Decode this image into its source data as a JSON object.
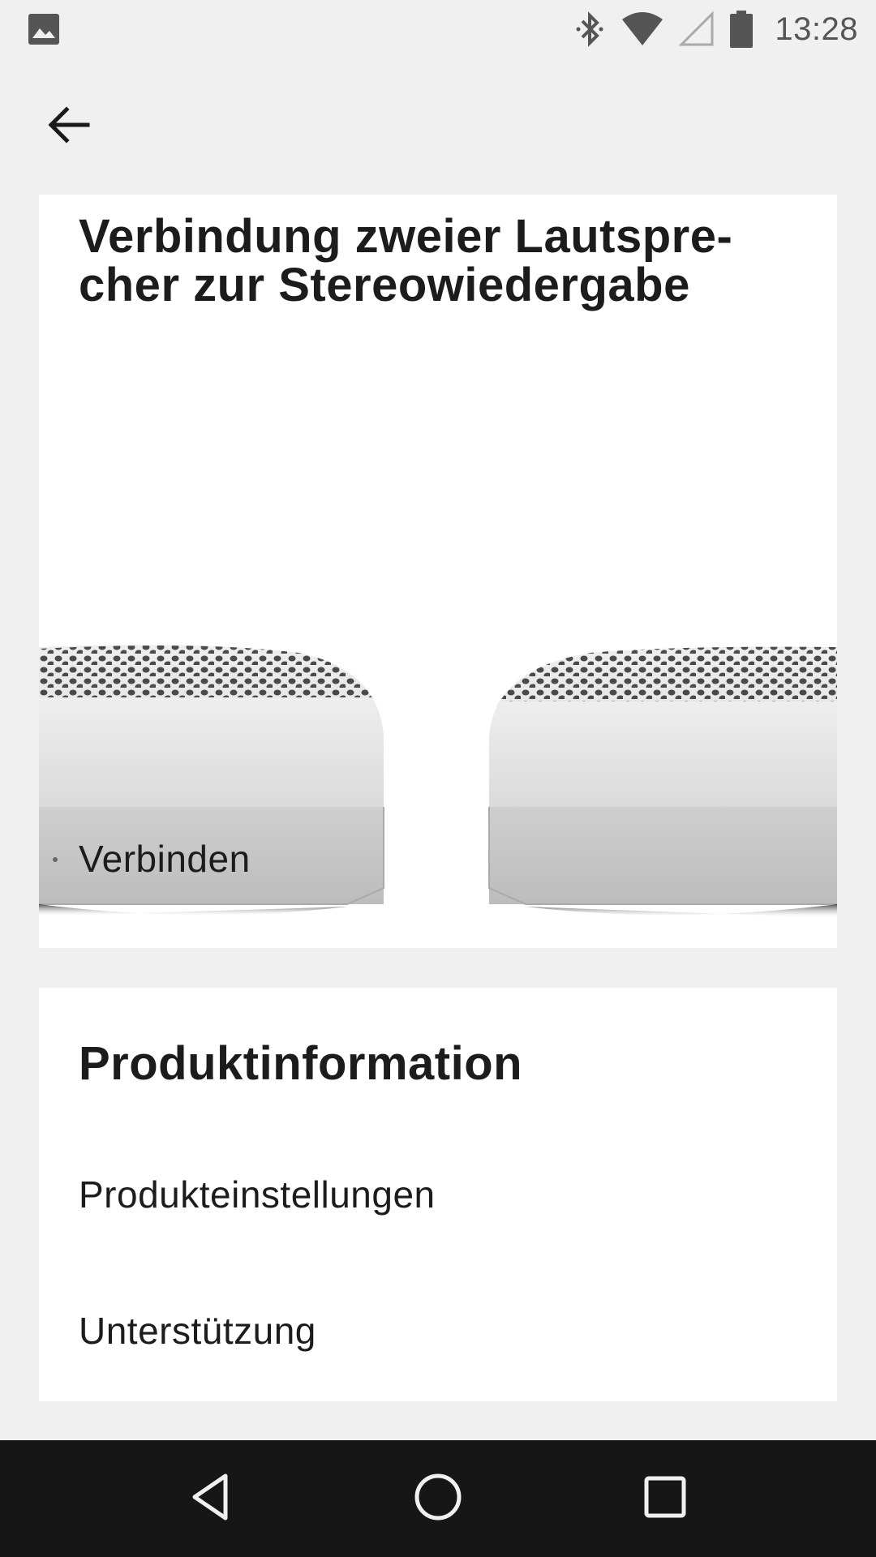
{
  "status_bar": {
    "time": "13:28",
    "icons": [
      "image-icon",
      "bluetooth-icon",
      "wifi-icon",
      "cellular-signal-icon",
      "battery-icon"
    ]
  },
  "app_bar": {
    "back_icon": "arrow-back-icon"
  },
  "stereo_card": {
    "title_line1": "Verbindung zweier Lautspre-",
    "title_line2": "cher zur Stereowiedergabe",
    "connect_label": "Verbinden"
  },
  "info_card": {
    "heading": "Produktinformation",
    "settings_label": "Produkteinstellungen",
    "support_label": "Unterstützung"
  },
  "nav_bar": {
    "icons": [
      "back-triangle-icon",
      "home-circle-icon",
      "recents-square-icon"
    ]
  },
  "colors": {
    "background": "#f0f0f0",
    "card": "#ffffff",
    "text": "#1c1c1c",
    "nav_bar": "#161616"
  }
}
